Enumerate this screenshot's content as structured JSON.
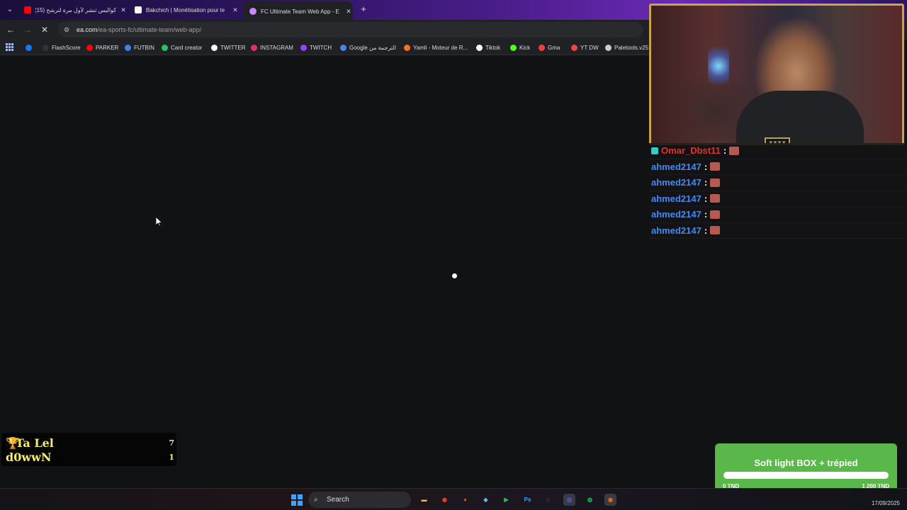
{
  "tabs": [
    {
      "title": "كواليس تنشر لأول مرة لترشح (15)",
      "favicon_color": "#ff0000",
      "active": false
    },
    {
      "title": "Bakchich | Monétisation pour le",
      "favicon_color": "#ffffff",
      "active": false
    },
    {
      "title": "FC Ultimate Team Web App - E",
      "favicon_color": "#cc88ff",
      "active": true
    }
  ],
  "toolbar": {
    "url_host": "ea.com",
    "url_path": "/ea-sports-fc/ultimate-team/web-app/"
  },
  "bookmarks": [
    {
      "label": "",
      "icon": "facebook-icon",
      "color": "#1877f2"
    },
    {
      "label": "FlashScore",
      "icon": "flashscore-icon",
      "color": "#333333"
    },
    {
      "label": "PARKER",
      "icon": "youtube-icon",
      "color": "#ff0000"
    },
    {
      "label": "FUTBIN",
      "icon": "futbin-icon",
      "color": "#3b82f6"
    },
    {
      "label": "Card creator",
      "icon": "card-creator-icon",
      "color": "#22c55e"
    },
    {
      "label": "TWITTER",
      "icon": "x-icon",
      "color": "#ffffff"
    },
    {
      "label": "INSTAGRAM",
      "icon": "instagram-icon",
      "color": "#e1306c"
    },
    {
      "label": "TWITCH",
      "icon": "twitch-icon",
      "color": "#9146ff"
    },
    {
      "label": "Google الترجمة من",
      "icon": "google-translate-icon",
      "color": "#4285f4"
    },
    {
      "label": "Yamli - Moteur de R...",
      "icon": "yamli-icon",
      "color": "#f97316"
    },
    {
      "label": "Tiktok",
      "icon": "tiktok-icon",
      "color": "#ffffff"
    },
    {
      "label": "Kick",
      "icon": "kick-icon",
      "color": "#53fc18"
    },
    {
      "label": "Gma",
      "icon": "gmail-icon",
      "color": "#ea4335"
    },
    {
      "label": "YT DW",
      "icon": "download-icon",
      "color": "#ef4444"
    },
    {
      "label": "Paletools.v25",
      "icon": "paletools-icon",
      "color": "#cccccc"
    }
  ],
  "chat": [
    {
      "user": "Omar_Dbst11",
      "color": "#e0342a",
      "badge": true
    },
    {
      "user": "ahmed2147",
      "color": "#3d8bf7",
      "badge": false
    },
    {
      "user": "ahmed2147",
      "color": "#3d8bf7",
      "badge": false
    },
    {
      "user": "ahmed2147",
      "color": "#3d8bf7",
      "badge": false
    },
    {
      "user": "ahmed2147",
      "color": "#3d8bf7",
      "badge": false
    },
    {
      "user": "ahmed2147",
      "color": "#3d8bf7",
      "badge": false
    }
  ],
  "chat_separator": ":",
  "score": {
    "trophy": "🏆",
    "player1": {
      "name": "Ta Lel",
      "score": "7"
    },
    "player2": {
      "name": "d0wwN",
      "score": "1"
    }
  },
  "goal": {
    "title": "Soft light BOX + trépied",
    "min_label": "0 TND",
    "max_label": "1 200 TND",
    "progress": 1.0
  },
  "taskbar": {
    "search_label": "Search",
    "apps": [
      {
        "name": "file-explorer-icon",
        "color": "#f5c542",
        "glyph": "▬"
      },
      {
        "name": "chrome-icon",
        "color": "#ea4335",
        "glyph": "◉"
      },
      {
        "name": "brave-icon",
        "color": "#fb542b",
        "glyph": "♦"
      },
      {
        "name": "steam-icon",
        "color": "#66c0f4",
        "glyph": "◈"
      },
      {
        "name": "app-icon",
        "color": "#22c55e",
        "glyph": "▶"
      },
      {
        "name": "photoshop-icon",
        "color": "#31a8ff",
        "glyph": "Ps"
      },
      {
        "name": "obs-icon",
        "color": "#dddddd",
        "glyph": "◌"
      },
      {
        "name": "discord-icon",
        "color": "#5865f2",
        "glyph": "◎"
      },
      {
        "name": "spotify-icon",
        "color": "#1db954",
        "glyph": "◍"
      },
      {
        "name": "browser-icon",
        "color": "#e8710a",
        "glyph": "◉"
      }
    ],
    "date": "17/09/2025"
  }
}
